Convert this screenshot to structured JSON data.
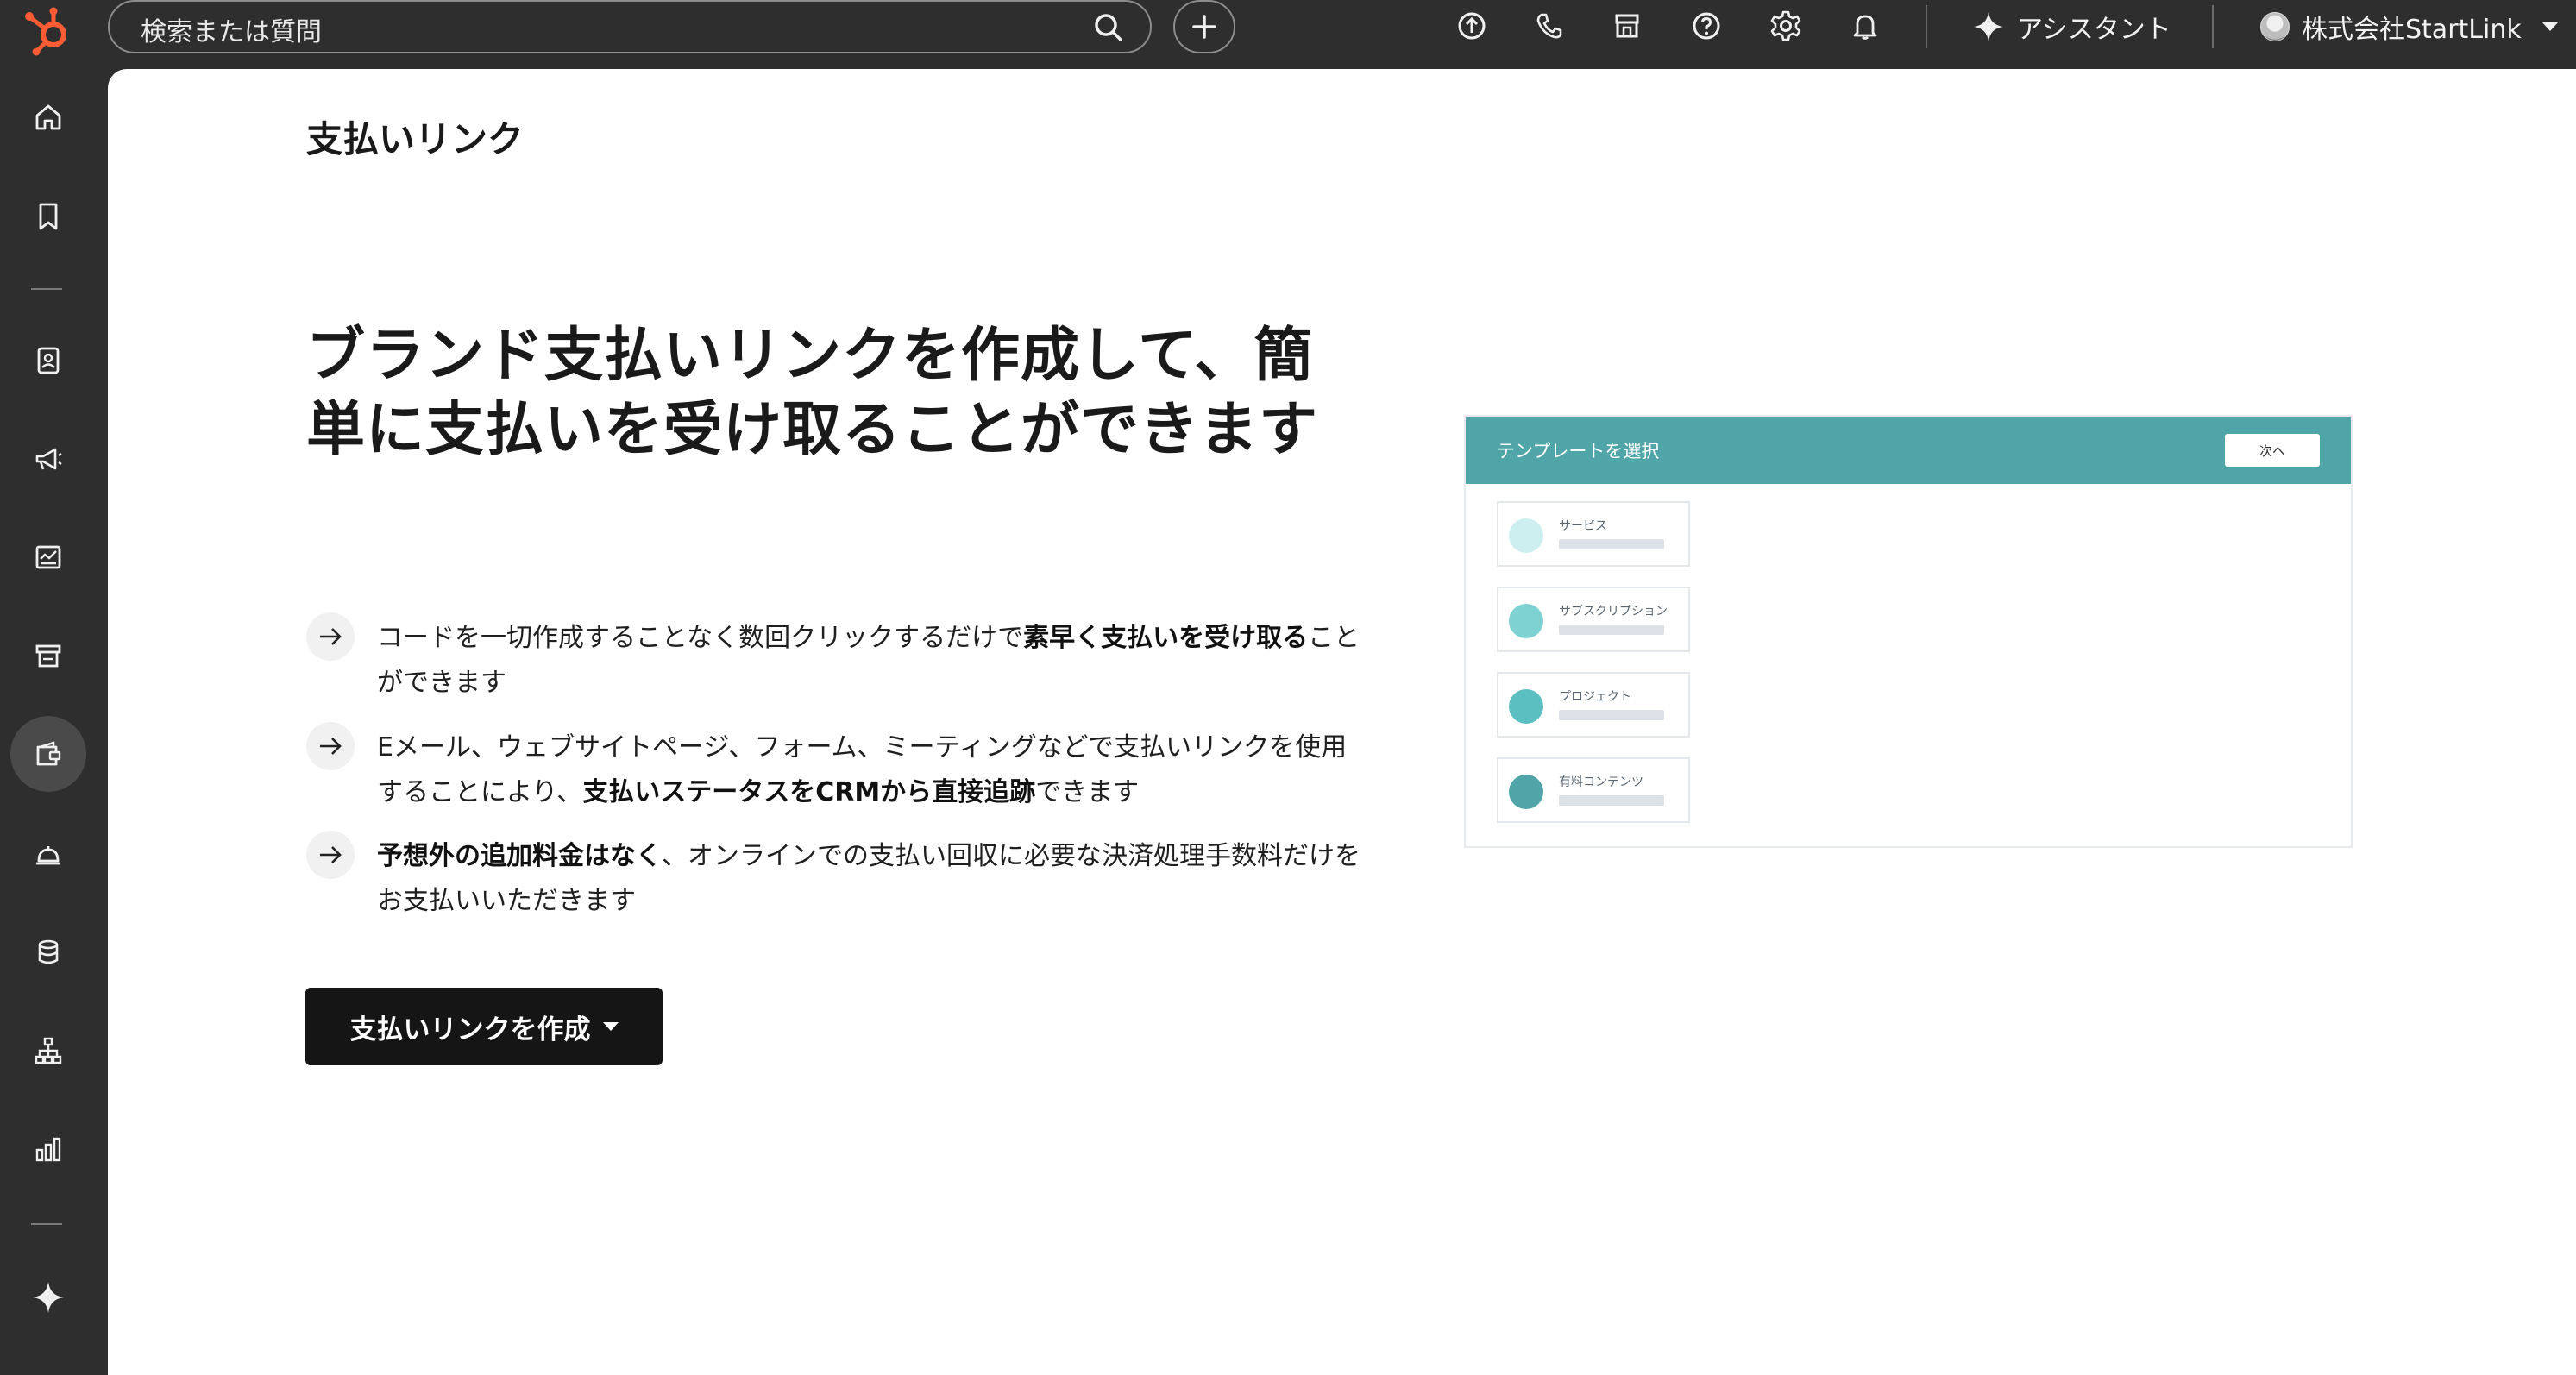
{
  "topbar": {
    "search_placeholder": "検索または質問",
    "assistant_label": "アシスタント",
    "account_name": "株式会社StartLink"
  },
  "page": {
    "title": "支払いリンク",
    "hero_title": "ブランド支払いリンクを作成して、簡単に支払いを受け取ることができます",
    "benefits": [
      {
        "pre": "コードを一切作成することなく数回クリックするだけで",
        "bold": "素早く支払いを受け取る",
        "post": "ことができます"
      },
      {
        "pre": "Eメール、ウェブサイトページ、フォーム、ミーティングなどで支払いリンクを使用することにより、",
        "bold": "支払いステータスをCRMから直接追跡",
        "post": "できます"
      },
      {
        "pre": "",
        "bold": "予想外の追加料金はなく",
        "post": "、オンラインでの支払い回収に必要な決済処理手数料だけをお支払いいただきます"
      }
    ],
    "cta_label": "支払いリンクを作成"
  },
  "illustration": {
    "header_title": "テンプレートを選択",
    "next_label": "次へ",
    "templates": [
      {
        "label": "サービス",
        "color": "#cdeff0"
      },
      {
        "label": "サブスクリプション",
        "color": "#7ed3d2"
      },
      {
        "label": "プロジェクト",
        "color": "#5bbfc1"
      },
      {
        "label": "有料コンテンツ",
        "color": "#4fa5a7"
      }
    ]
  },
  "colors": {
    "chrome": "#2e2e2e",
    "brand_orange": "#ff5c35",
    "teal": "#4fa5a7",
    "cta": "#151515"
  }
}
